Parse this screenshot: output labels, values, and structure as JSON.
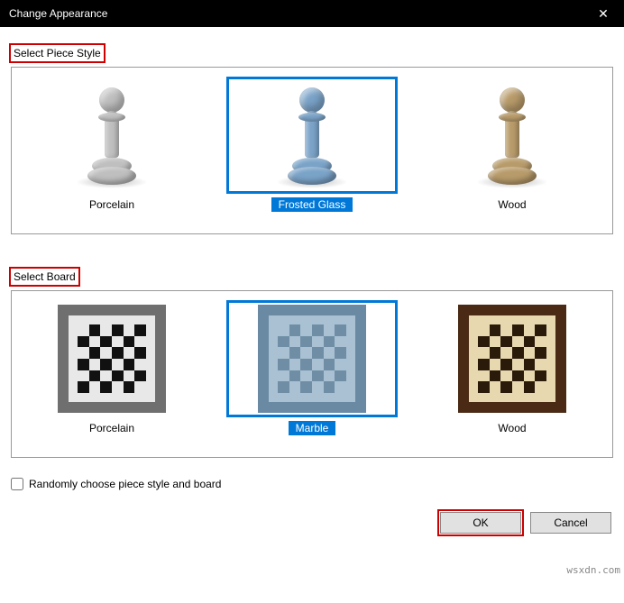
{
  "window": {
    "title": "Change Appearance",
    "close_icon": "✕"
  },
  "sections": {
    "piece_style": {
      "label": "Select Piece Style",
      "options": [
        {
          "label": "Porcelain",
          "selected": false,
          "color": "#bfbfbf"
        },
        {
          "label": "Frosted Glass",
          "selected": true,
          "color": "#7aa3c8"
        },
        {
          "label": "Wood",
          "selected": false,
          "color": "#b89b6a"
        }
      ]
    },
    "board_style": {
      "label": "Select Board",
      "options": [
        {
          "label": "Porcelain",
          "selected": false,
          "frame": "#6f6f6f",
          "light": "#e8e8e8",
          "dark": "#111"
        },
        {
          "label": "Marble",
          "selected": true,
          "frame": "#6a8aa4",
          "light": "#a9c1d2",
          "dark": "#6f8ea6"
        },
        {
          "label": "Wood",
          "selected": false,
          "frame": "#4a2a14",
          "light": "#e8d8b0",
          "dark": "#2a1a0a"
        }
      ]
    }
  },
  "checkbox": {
    "label": "Randomly choose piece style and board",
    "checked": false
  },
  "buttons": {
    "ok": "OK",
    "cancel": "Cancel"
  },
  "watermark": "wsxdn.com"
}
